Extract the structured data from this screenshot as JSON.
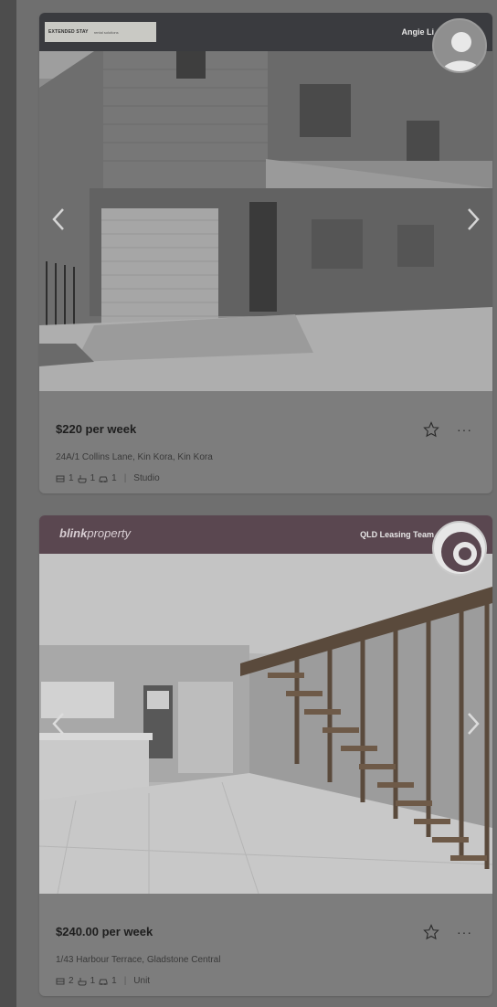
{
  "listings": [
    {
      "brand": {
        "line1": "EXTENDED STAY",
        "line2": "rental solutions"
      },
      "agent": "Angie Li",
      "price": "$220 per week",
      "address": "24A/1 Collins Lane, Kin Kora, Kin Kora",
      "features": {
        "bed": "1",
        "bath": "1",
        "car": "1",
        "type": "Studio"
      },
      "more_label": "···"
    },
    {
      "brand": {
        "bold": "blink",
        "light": "property"
      },
      "agent": "QLD Leasing Team",
      "price": "$240.00 per week",
      "address": "1/43 Harbour Terrace, Gladstone Central",
      "features": {
        "bed": "2",
        "bath": "1",
        "car": "1",
        "type": "Unit"
      },
      "more_label": "···"
    }
  ],
  "icons": {
    "favorite": "star-outline-icon",
    "more": "more-horizontal-icon",
    "prev": "chevron-left-icon",
    "next": "chevron-right-icon",
    "bed": "bed-icon",
    "bath": "bath-icon",
    "car": "car-icon"
  }
}
